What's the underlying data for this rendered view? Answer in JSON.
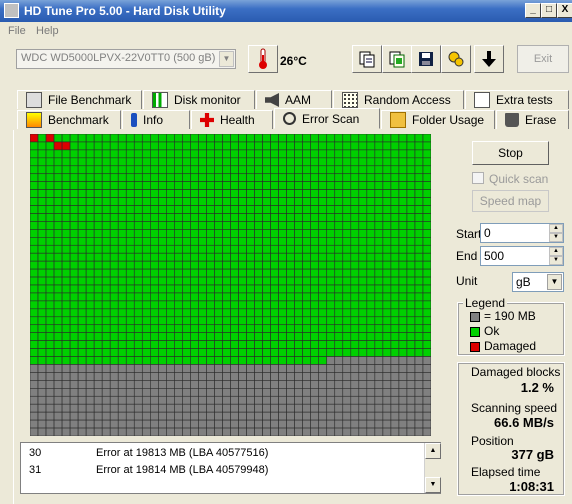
{
  "window": {
    "title": "HD Tune Pro 5.00 - Hard Disk Utility",
    "controls": [
      "_",
      "□",
      "X"
    ]
  },
  "menu": {
    "items": [
      "File",
      "Help"
    ]
  },
  "toolbar": {
    "drive": "WDC WD5000LPVX-22V0TT0 (500 gB)",
    "temperature": "26°C",
    "exit_label": "Exit"
  },
  "tabs_row1": [
    {
      "label": "File Benchmark",
      "icon": "file-benchmark-icon"
    },
    {
      "label": "Disk monitor",
      "icon": "disk-monitor-icon"
    },
    {
      "label": "AAM",
      "icon": "speaker-icon"
    },
    {
      "label": "Random Access",
      "icon": "random-access-icon"
    },
    {
      "label": "Extra tests",
      "icon": "extra-tests-icon"
    }
  ],
  "tabs_row2": [
    {
      "label": "Benchmark",
      "icon": "benchmark-icon"
    },
    {
      "label": "Info",
      "icon": "info-icon"
    },
    {
      "label": "Health",
      "icon": "health-icon"
    },
    {
      "label": "Error Scan",
      "icon": "magnifier-icon",
      "active": true
    },
    {
      "label": "Folder Usage",
      "icon": "folder-icon"
    },
    {
      "label": "Erase",
      "icon": "trash-icon"
    }
  ],
  "scan_grid": {
    "columns": 50,
    "rows": 38,
    "scanned_full_rows": 28,
    "partial_row_green_cells": 37,
    "damaged_cells": [
      [
        0,
        0
      ],
      [
        0,
        2
      ],
      [
        1,
        3
      ],
      [
        1,
        4
      ]
    ],
    "colors": {
      "ok": "#00d000",
      "unscanned": "#808080",
      "damaged": "#dd0000",
      "gridline": "#2a2a2a"
    }
  },
  "log": {
    "rows": [
      {
        "num": "30",
        "text": "Error at 19813 MB (LBA 40577516)"
      },
      {
        "num": "31",
        "text": "Error at 19814 MB (LBA 40579948)"
      }
    ]
  },
  "controls": {
    "stop_label": "Stop",
    "quick_scan_label": "Quick scan",
    "speed_map_label": "Speed map",
    "start_label": "Start",
    "start_value": "0",
    "end_label": "End",
    "end_value": "500",
    "unit_label": "Unit",
    "unit_value": "gB"
  },
  "legend": {
    "title": "Legend",
    "items": [
      {
        "label": "= 190 MB",
        "color": "#808080"
      },
      {
        "label": "Ok",
        "color": "#00d000"
      },
      {
        "label": "Damaged",
        "color": "#dd0000"
      }
    ]
  },
  "stats": {
    "damaged_label": "Damaged blocks",
    "damaged_value": "1.2 %",
    "speed_label": "Scanning speed",
    "speed_value": "66.6 MB/s",
    "position_label": "Position",
    "position_value": "377 gB",
    "elapsed_label": "Elapsed time",
    "elapsed_value": "1:08:31"
  }
}
